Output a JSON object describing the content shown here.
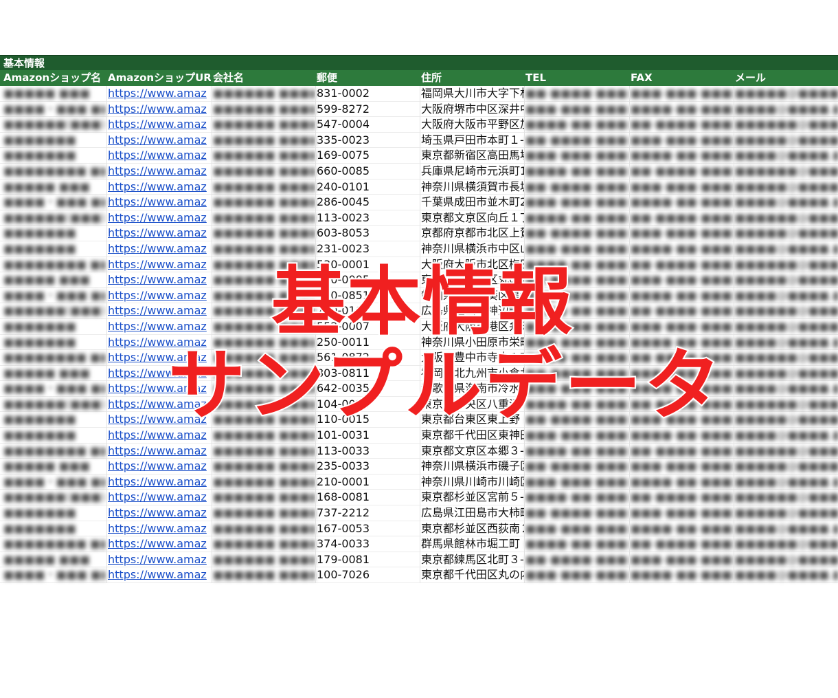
{
  "sheet": {
    "title": "基本情報",
    "columns": [
      "Amazonショップ名",
      "AmazonショップURL",
      "会社名",
      "郵便",
      "住所",
      "TEL",
      "FAX",
      "メール"
    ],
    "url_text": "https://www.amaz",
    "rows": [
      {
        "zip": "831-0002",
        "addr": "福岡県大川市大字下林"
      },
      {
        "zip": "599-8272",
        "addr": "大阪府堺市中区深井中"
      },
      {
        "zip": "547-0004",
        "addr": "大阪府大阪市平野区加"
      },
      {
        "zip": "335-0023",
        "addr": "埼玉県戸田市本町１-"
      },
      {
        "zip": "169-0075",
        "addr": "東京都新宿区高田馬場"
      },
      {
        "zip": "660-0085",
        "addr": "兵庫県尼崎市元浜町1"
      },
      {
        "zip": "240-0101",
        "addr": "神奈川県横須賀市長坂"
      },
      {
        "zip": "286-0045",
        "addr": "千葉県成田市並木町2"
      },
      {
        "zip": "113-0023",
        "addr": "東京都文京区向丘１丁"
      },
      {
        "zip": "603-8053",
        "addr": "京都府京都市北区上賀"
      },
      {
        "zip": "231-0023",
        "addr": "神奈川県横浜市中区山"
      },
      {
        "zip": "530-0001",
        "addr": "大阪府大阪市北区梅田"
      },
      {
        "zip": "100-0005",
        "addr": "東京都千代田区丸の内"
      },
      {
        "zip": "420-0851",
        "addr": "静岡県静岡市葵区黒金"
      },
      {
        "zip": "720-0102",
        "addr": "広島県福山市神辺町川"
      },
      {
        "zip": "552-0007",
        "addr": "大阪府大阪市港区弁天"
      },
      {
        "zip": "250-0011",
        "addr": "神奈川県小田原市栄町"
      },
      {
        "zip": "561-0872",
        "addr": "大阪府豊中市寺内１丁"
      },
      {
        "zip": "803-0811",
        "addr": "福岡県北九州市小倉北"
      },
      {
        "zip": "642-0035",
        "addr": "和歌山県海南市冷水"
      },
      {
        "zip": "104-0028",
        "addr": "東京都中央区八重洲"
      },
      {
        "zip": "110-0015",
        "addr": "東京都台東区東上野"
      },
      {
        "zip": "101-0031",
        "addr": "東京都千代田区東神田"
      },
      {
        "zip": "113-0033",
        "addr": "東京都文京区本郷３-"
      },
      {
        "zip": "235-0033",
        "addr": "神奈川県横浜市磯子区"
      },
      {
        "zip": "210-0001",
        "addr": "神奈川県川崎市川崎区"
      },
      {
        "zip": "168-0081",
        "addr": "東京都杉並区宮前５-"
      },
      {
        "zip": "737-2212",
        "addr": "広島県江田島市大柿町"
      },
      {
        "zip": "167-0053",
        "addr": "東京都杉並区西荻南２"
      },
      {
        "zip": "374-0033",
        "addr": "群馬県館林市堀工町"
      },
      {
        "zip": "179-0081",
        "addr": "東京都練馬区北町３-"
      },
      {
        "zip": "100-7026",
        "addr": "東京都千代田区丸の内"
      }
    ]
  },
  "overlay": {
    "line1": "基本情報",
    "line2": "サンプルデータ",
    "color": "#f02020"
  }
}
